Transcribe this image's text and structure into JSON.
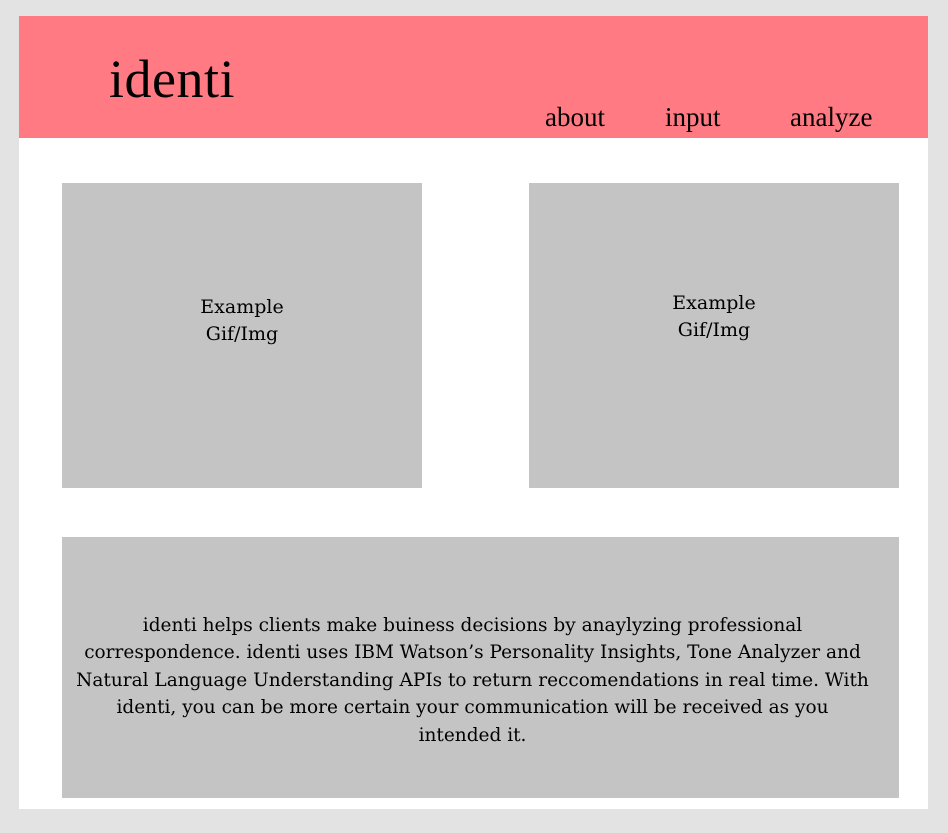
{
  "app": {
    "brand": "identi"
  },
  "nav": {
    "items": [
      {
        "label": "about"
      },
      {
        "label": "input"
      },
      {
        "label": "analyze"
      }
    ]
  },
  "media": {
    "left": {
      "line1": "Example",
      "line2": "Gif/Img"
    },
    "right": {
      "line1": "Example",
      "line2": "Gif/Img"
    }
  },
  "about": {
    "text": "identi helps clients make buiness decisions by anaylyzing professional correspondence. identi uses IBM Watson’s Personality Insights, Tone Analyzer and Natural Language Understanding APIs to return reccomendations in real time. With identi, you can be more certain your communication will be received as you intended it."
  },
  "colors": {
    "header": "#ff7a82",
    "page_background": "#e3e3e3",
    "content_background": "#ffffff",
    "placeholder": "#c4c4c4",
    "text": "#000000"
  }
}
